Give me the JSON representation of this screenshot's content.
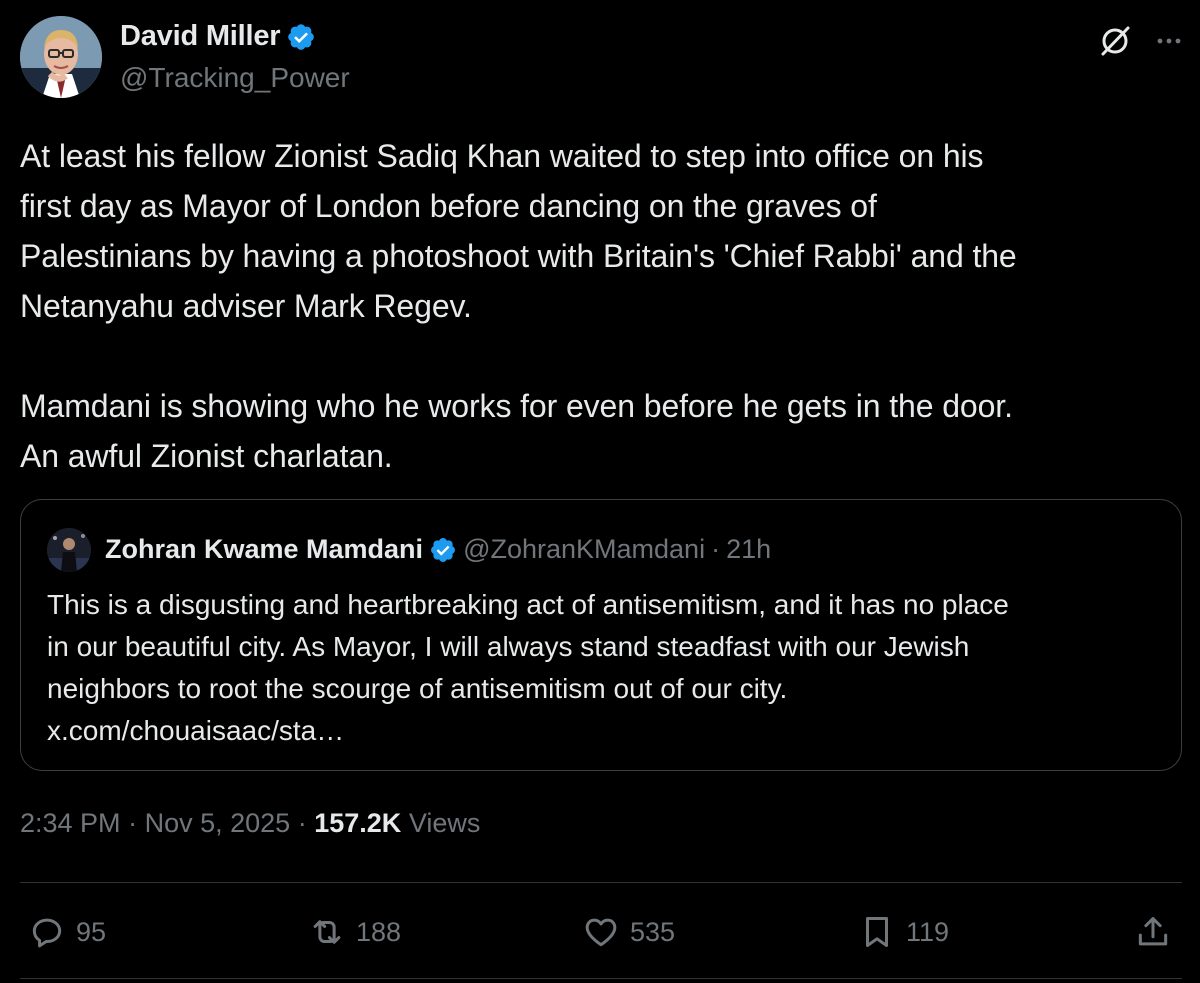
{
  "author": {
    "display_name": "David Miller",
    "handle": "@Tracking_Power",
    "verified": true
  },
  "header_icons": {
    "grok": "grok-icon",
    "more": "more-options-icon"
  },
  "tweet": {
    "text": "At least his fellow Zionist Sadiq Khan waited to step into office on his\nfirst day as Mayor of London before dancing on the graves of\nPalestinians by having a photoshoot with Britain's 'Chief Rabbi' and the\nNetanyahu adviser Mark Regev.\n\nMamdani is showing who he works for even before he gets in the door.\nAn awful Zionist charlatan."
  },
  "quote": {
    "display_name": "Zohran Kwame Mamdani",
    "handle": "@ZohranKMamdani",
    "separator": "·",
    "time": "21h",
    "verified": true,
    "text": "This is a disgusting and heartbreaking act of antisemitism, and it has no place\nin our beautiful city. As Mayor, I will always stand steadfast with our Jewish\nneighbors to root the scourge of antisemitism out of our city.\nx.com/chouaisaac/sta…"
  },
  "meta": {
    "time": "2:34 PM",
    "separator": "·",
    "date": "Nov 5, 2025",
    "views_count": "157.2K",
    "views_label": "Views"
  },
  "actions": {
    "replies": "95",
    "reposts": "188",
    "likes": "535",
    "bookmarks": "119"
  },
  "colors": {
    "background": "#000000",
    "text": "#e7e9ea",
    "muted": "#71767b",
    "verified": "#1d9bf0",
    "border": "#2f3336"
  }
}
